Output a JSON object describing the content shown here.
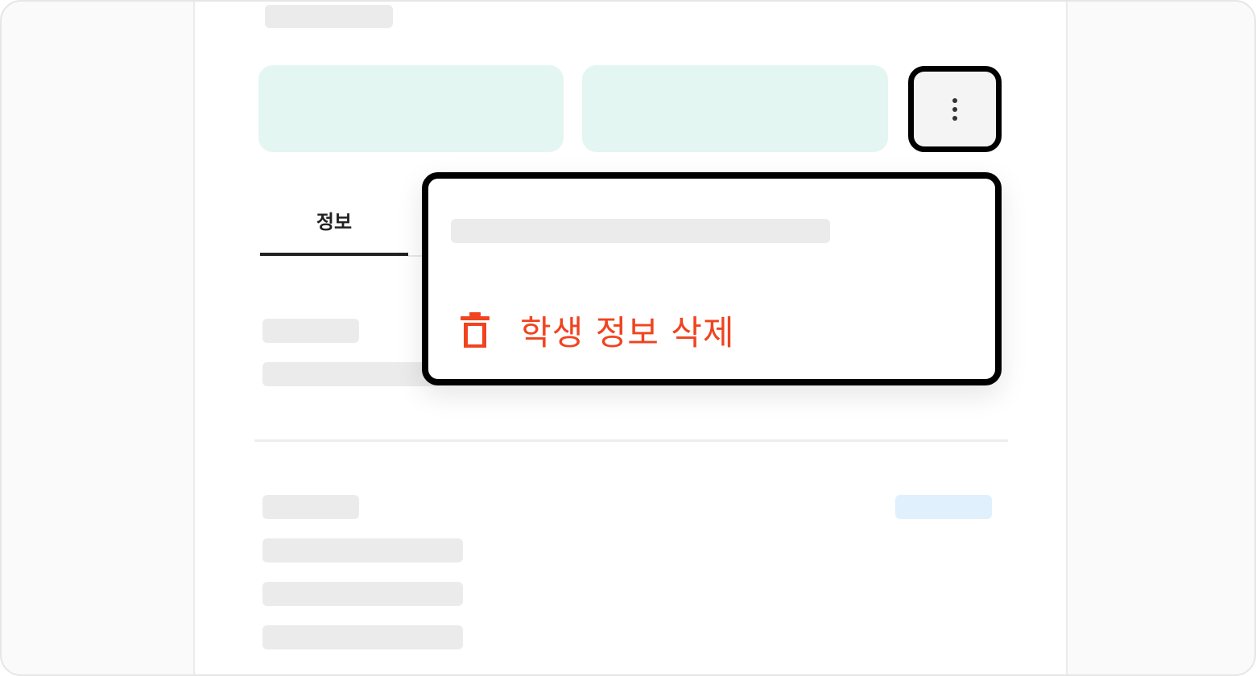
{
  "tabs": [
    {
      "label": "정보",
      "active": true
    }
  ],
  "more_menu": {
    "icon": "more-vertical-icon",
    "items": [
      {
        "label": "학생 정보 삭제",
        "icon": "trash-icon",
        "color": "#f0431f"
      }
    ]
  },
  "colors": {
    "accent_danger": "#f0431f",
    "action_card": "#e3f6f1",
    "badge": "#e0f0fd",
    "placeholder": "#ebebeb"
  }
}
